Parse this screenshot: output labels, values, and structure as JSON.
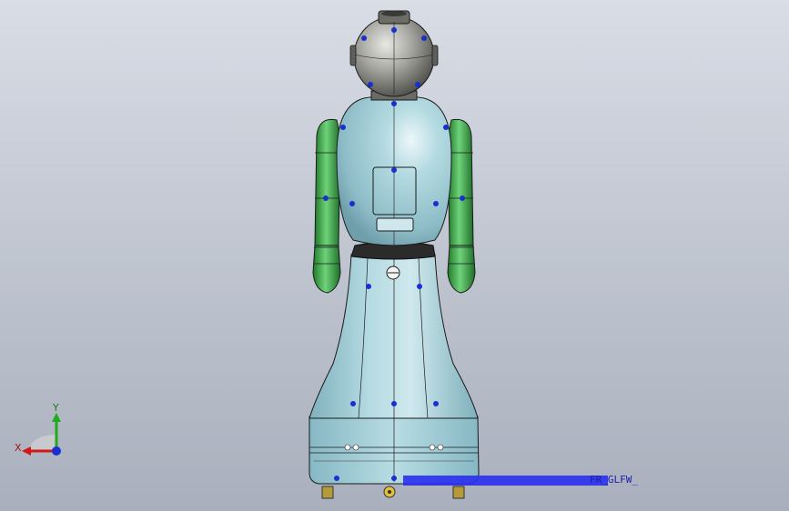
{
  "viewport": {
    "view_orientation": "front",
    "background": [
      "#d9dde6",
      "#a9afbc"
    ]
  },
  "model": {
    "colors": {
      "head": "#9a9a96",
      "body": "#a6cdd6",
      "arms": "#3fa24a",
      "outline": "#1a1a1a",
      "points": "#1a2fd0"
    }
  },
  "triad": {
    "x_label": "X",
    "y_label": "Y",
    "x_color": "#d01818",
    "y_color": "#1faa1f",
    "z_color": "#1a2fd0"
  },
  "annotation": {
    "text": "FR_GLFW_",
    "color": "#2a2ff0"
  }
}
